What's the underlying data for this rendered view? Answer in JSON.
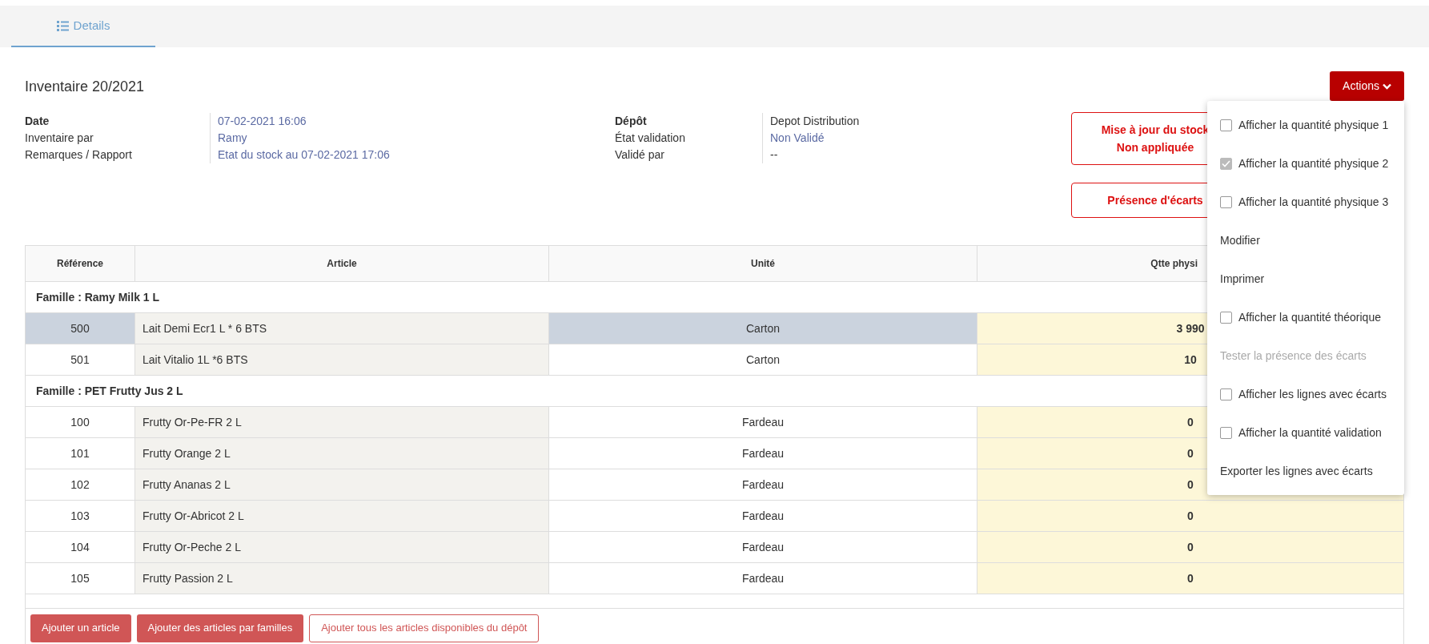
{
  "tabs": [
    {
      "label": "Details",
      "selected": true
    }
  ],
  "title": "Inventaire 20/2021",
  "info_left": [
    {
      "label": "Date",
      "value": "07-02-2021 16:06",
      "bold": true,
      "link": true
    },
    {
      "label": "Inventaire par",
      "value": "Ramy",
      "bold": false,
      "link": true
    },
    {
      "label": "Remarques / Rapport",
      "value": "Etat du stock au 07-02-2021 17:06",
      "bold": false,
      "link": true
    }
  ],
  "info_right": [
    {
      "label": "Dépôt",
      "value": "Depot Distribution",
      "bold": true,
      "link": false
    },
    {
      "label": "État validation",
      "value": "Non Validé",
      "bold": false,
      "link": true
    },
    {
      "label": "Validé par",
      "value": "--",
      "bold": false,
      "link": false
    }
  ],
  "status_boxes": [
    [
      "Mise à jour du stock",
      "Non appliquée"
    ],
    [
      "Présence d'écarts"
    ]
  ],
  "actions_button": "Actions",
  "actions_menu": [
    {
      "kind": "checkbox",
      "label": "Afficher la quantité physique 1",
      "checked": false
    },
    {
      "kind": "checkbox",
      "label": "Afficher la quantité physique 2",
      "checked": true
    },
    {
      "kind": "checkbox",
      "label": "Afficher la quantité physique 3",
      "checked": false
    },
    {
      "kind": "action",
      "label": "Modifier",
      "disabled": false
    },
    {
      "kind": "action",
      "label": "Imprimer",
      "disabled": false
    },
    {
      "kind": "checkbox",
      "label": "Afficher la quantité théorique",
      "checked": false
    },
    {
      "kind": "action",
      "label": "Tester la présence des écarts",
      "disabled": true
    },
    {
      "kind": "checkbox",
      "label": "Afficher les lignes avec écarts",
      "checked": false
    },
    {
      "kind": "checkbox",
      "label": "Afficher la quantité validation",
      "checked": false
    },
    {
      "kind": "action",
      "label": "Exporter les lignes avec écarts",
      "disabled": false
    }
  ],
  "table": {
    "columns": [
      "Référence",
      "Article",
      "Unité",
      "Qtte physi"
    ],
    "groups": [
      {
        "name": "Famille : Ramy Milk 1 L",
        "rows": [
          {
            "reference": "500",
            "article": "Lait Demi Ecr1 L * 6 BTS",
            "unit": "Carton",
            "qty": "3 990",
            "selected": true
          },
          {
            "reference": "501",
            "article": "Lait Vitalio 1L *6 BTS",
            "unit": "Carton",
            "qty": "10",
            "selected": false
          }
        ]
      },
      {
        "name": "Famille : PET Frutty Jus 2 L",
        "rows": [
          {
            "reference": "100",
            "article": "Frutty Or-Pe-FR 2 L",
            "unit": "Fardeau",
            "qty": "0",
            "selected": false
          },
          {
            "reference": "101",
            "article": "Frutty Orange 2 L",
            "unit": "Fardeau",
            "qty": "0",
            "selected": false
          },
          {
            "reference": "102",
            "article": "Frutty Ananas 2 L",
            "unit": "Fardeau",
            "qty": "0",
            "selected": false
          },
          {
            "reference": "103",
            "article": "Frutty Or-Abricot 2 L",
            "unit": "Fardeau",
            "qty": "0",
            "selected": false
          },
          {
            "reference": "104",
            "article": "Frutty Or-Peche 2 L",
            "unit": "Fardeau",
            "qty": "0",
            "selected": false
          },
          {
            "reference": "105",
            "article": "Frutty Passion 2 L",
            "unit": "Fardeau",
            "qty": "0",
            "selected": false
          }
        ]
      }
    ]
  },
  "footer_buttons": [
    {
      "label": "Ajouter un article",
      "kind": "solid"
    },
    {
      "label": "Ajouter des articles par familles",
      "kind": "solid"
    },
    {
      "label": "Ajouter tous les articles disponibles du dépôt",
      "kind": "outline"
    }
  ]
}
